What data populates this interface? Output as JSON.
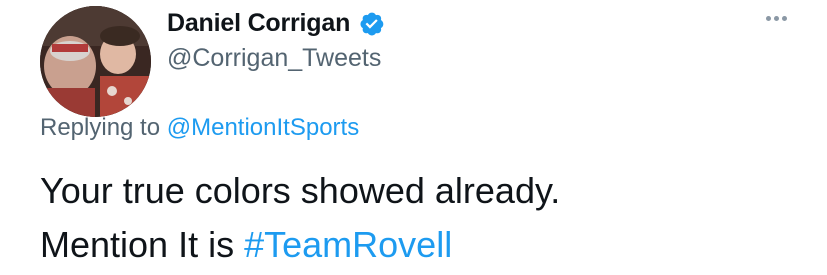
{
  "author": {
    "display_name": "Daniel Corrigan",
    "handle": "@Corrigan_Tweets",
    "verified": true,
    "avatar_icon": "profile-photo"
  },
  "actions": {
    "more_icon": "more-horizontal-icon"
  },
  "reply": {
    "prefix": "Replying to",
    "mention": "@MentionItSports"
  },
  "body": {
    "line1": "Your true colors showed already.",
    "line2_text": "Mention It is",
    "line2_hashtag": "#TeamRovell"
  },
  "colors": {
    "text": "#0f1419",
    "secondary": "#536471",
    "link": "#1d9bf0",
    "verified_badge": "#1d9bf0"
  }
}
